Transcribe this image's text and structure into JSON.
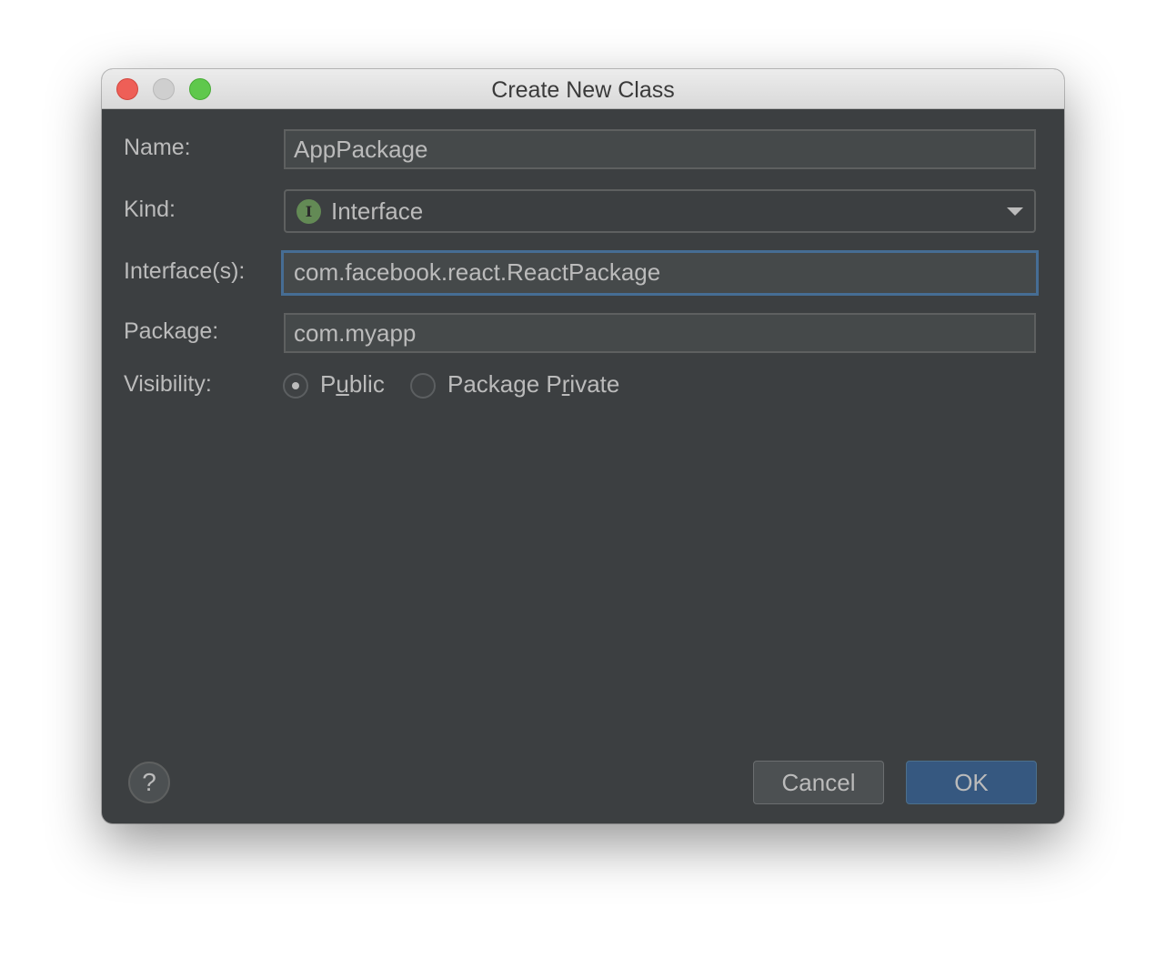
{
  "window": {
    "title": "Create New Class"
  },
  "form": {
    "name_label": "Name:",
    "name_value": "AppPackage",
    "kind_label": "Kind:",
    "kind_value": "Interface",
    "kind_icon": "interface-icon",
    "kind_icon_glyph": "I",
    "interfaces_label": "Interface(s):",
    "interfaces_value": "com.facebook.react.ReactPackage",
    "package_label": "Package:",
    "package_value": "com.myapp",
    "visibility_label": "Visibility:",
    "visibility_options": [
      {
        "pre": "P",
        "mnemonic": "u",
        "post": "blic",
        "label": "Public",
        "selected": true
      },
      {
        "pre": "Package P",
        "mnemonic": "r",
        "post": "ivate",
        "label": "Package Private",
        "selected": false
      }
    ]
  },
  "footer": {
    "help_glyph": "?",
    "cancel_label": "Cancel",
    "ok_label": "OK"
  },
  "colors": {
    "background": "#3c3f41",
    "field_background": "#45494a",
    "text": "#bbbbbb",
    "focus_border": "#466d94",
    "default_button": "#365880",
    "interface_icon": "#638a55"
  }
}
